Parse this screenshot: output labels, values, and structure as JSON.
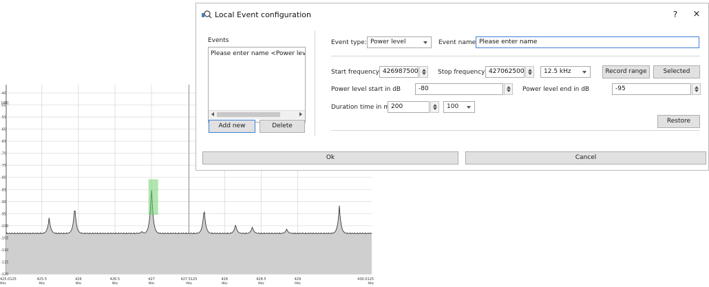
{
  "dialog": {
    "title": "Local Event configuration",
    "help": "?",
    "close": "×"
  },
  "events": {
    "label": "Events",
    "items": [
      "Please enter name <Power leve"
    ],
    "add_new": "Add new",
    "delete": "Delete"
  },
  "form": {
    "event_type_label": "Event type:",
    "event_type_value": "Power level",
    "event_name_label": "Event name:",
    "event_name_value": "Please enter name",
    "start_freq_label": "Start frequency",
    "start_freq_value": "426987500",
    "stop_freq_label": "Stop frequency",
    "stop_freq_value": "427062500",
    "step_value": "12.5 kHz",
    "record_range": "Record range",
    "selected": "Selected",
    "power_start_label": "Power level start in dB",
    "power_start_value": "-80",
    "power_end_label": "Power level end in dB",
    "power_end_value": "-95",
    "duration_label": "Duration time in ms",
    "duration_value": "200",
    "duration_step": "100",
    "restore": "Restore"
  },
  "footer": {
    "ok": "Ok",
    "cancel": "Cancel"
  },
  "colors": {
    "accent": "#3c7fd6",
    "highlight": "#6fd36f",
    "trace_fill": "#cfcfcf"
  },
  "chart_data": {
    "type": "area",
    "y_unit": "[dB]",
    "y_ticks": [
      "-40",
      "-50",
      "-55",
      "-60",
      "-65",
      "-70",
      "-75",
      "-80",
      "-85",
      "-90",
      "-95",
      "-100",
      "-105",
      "-110",
      "-115",
      "-120"
    ],
    "x_ticks": [
      {
        "value": 425.0125,
        "label": "425.0125",
        "unit": "MHz"
      },
      {
        "value": 425.5,
        "label": "425.5",
        "unit": "MHz"
      },
      {
        "value": 426,
        "label": "426",
        "unit": "MHz"
      },
      {
        "value": 426.5,
        "label": "426.5",
        "unit": "MHz"
      },
      {
        "value": 427,
        "label": "427",
        "unit": "MHz"
      },
      {
        "value": 427.5125,
        "label": "427.5125",
        "unit": "MHz"
      },
      {
        "value": 428,
        "label": "428",
        "unit": "MHz"
      },
      {
        "value": 428.5,
        "label": "428.5",
        "unit": "MHz"
      },
      {
        "value": 429,
        "label": "429",
        "unit": "MHz"
      },
      {
        "value": 430.0125,
        "label": "430.0125",
        "unit": "MHz"
      }
    ],
    "xlim": [
      425.0125,
      430.0125
    ],
    "ylim": [
      -120,
      -40
    ],
    "baseline_db": -103,
    "peaks": [
      {
        "x": 425.6,
        "y": -96
      },
      {
        "x": 425.95,
        "y": -91
      },
      {
        "x": 426.87,
        "y": -102
      },
      {
        "x": 427.0,
        "y": -82
      },
      {
        "x": 427.72,
        "y": -92
      },
      {
        "x": 428.15,
        "y": -99
      },
      {
        "x": 428.38,
        "y": -100
      },
      {
        "x": 428.85,
        "y": -101
      },
      {
        "x": 429.57,
        "y": -91
      }
    ],
    "event_band": {
      "x_start": 426.9875,
      "x_end": 427.0625,
      "y_start": -80,
      "y_end": -95
    },
    "grid": true
  }
}
